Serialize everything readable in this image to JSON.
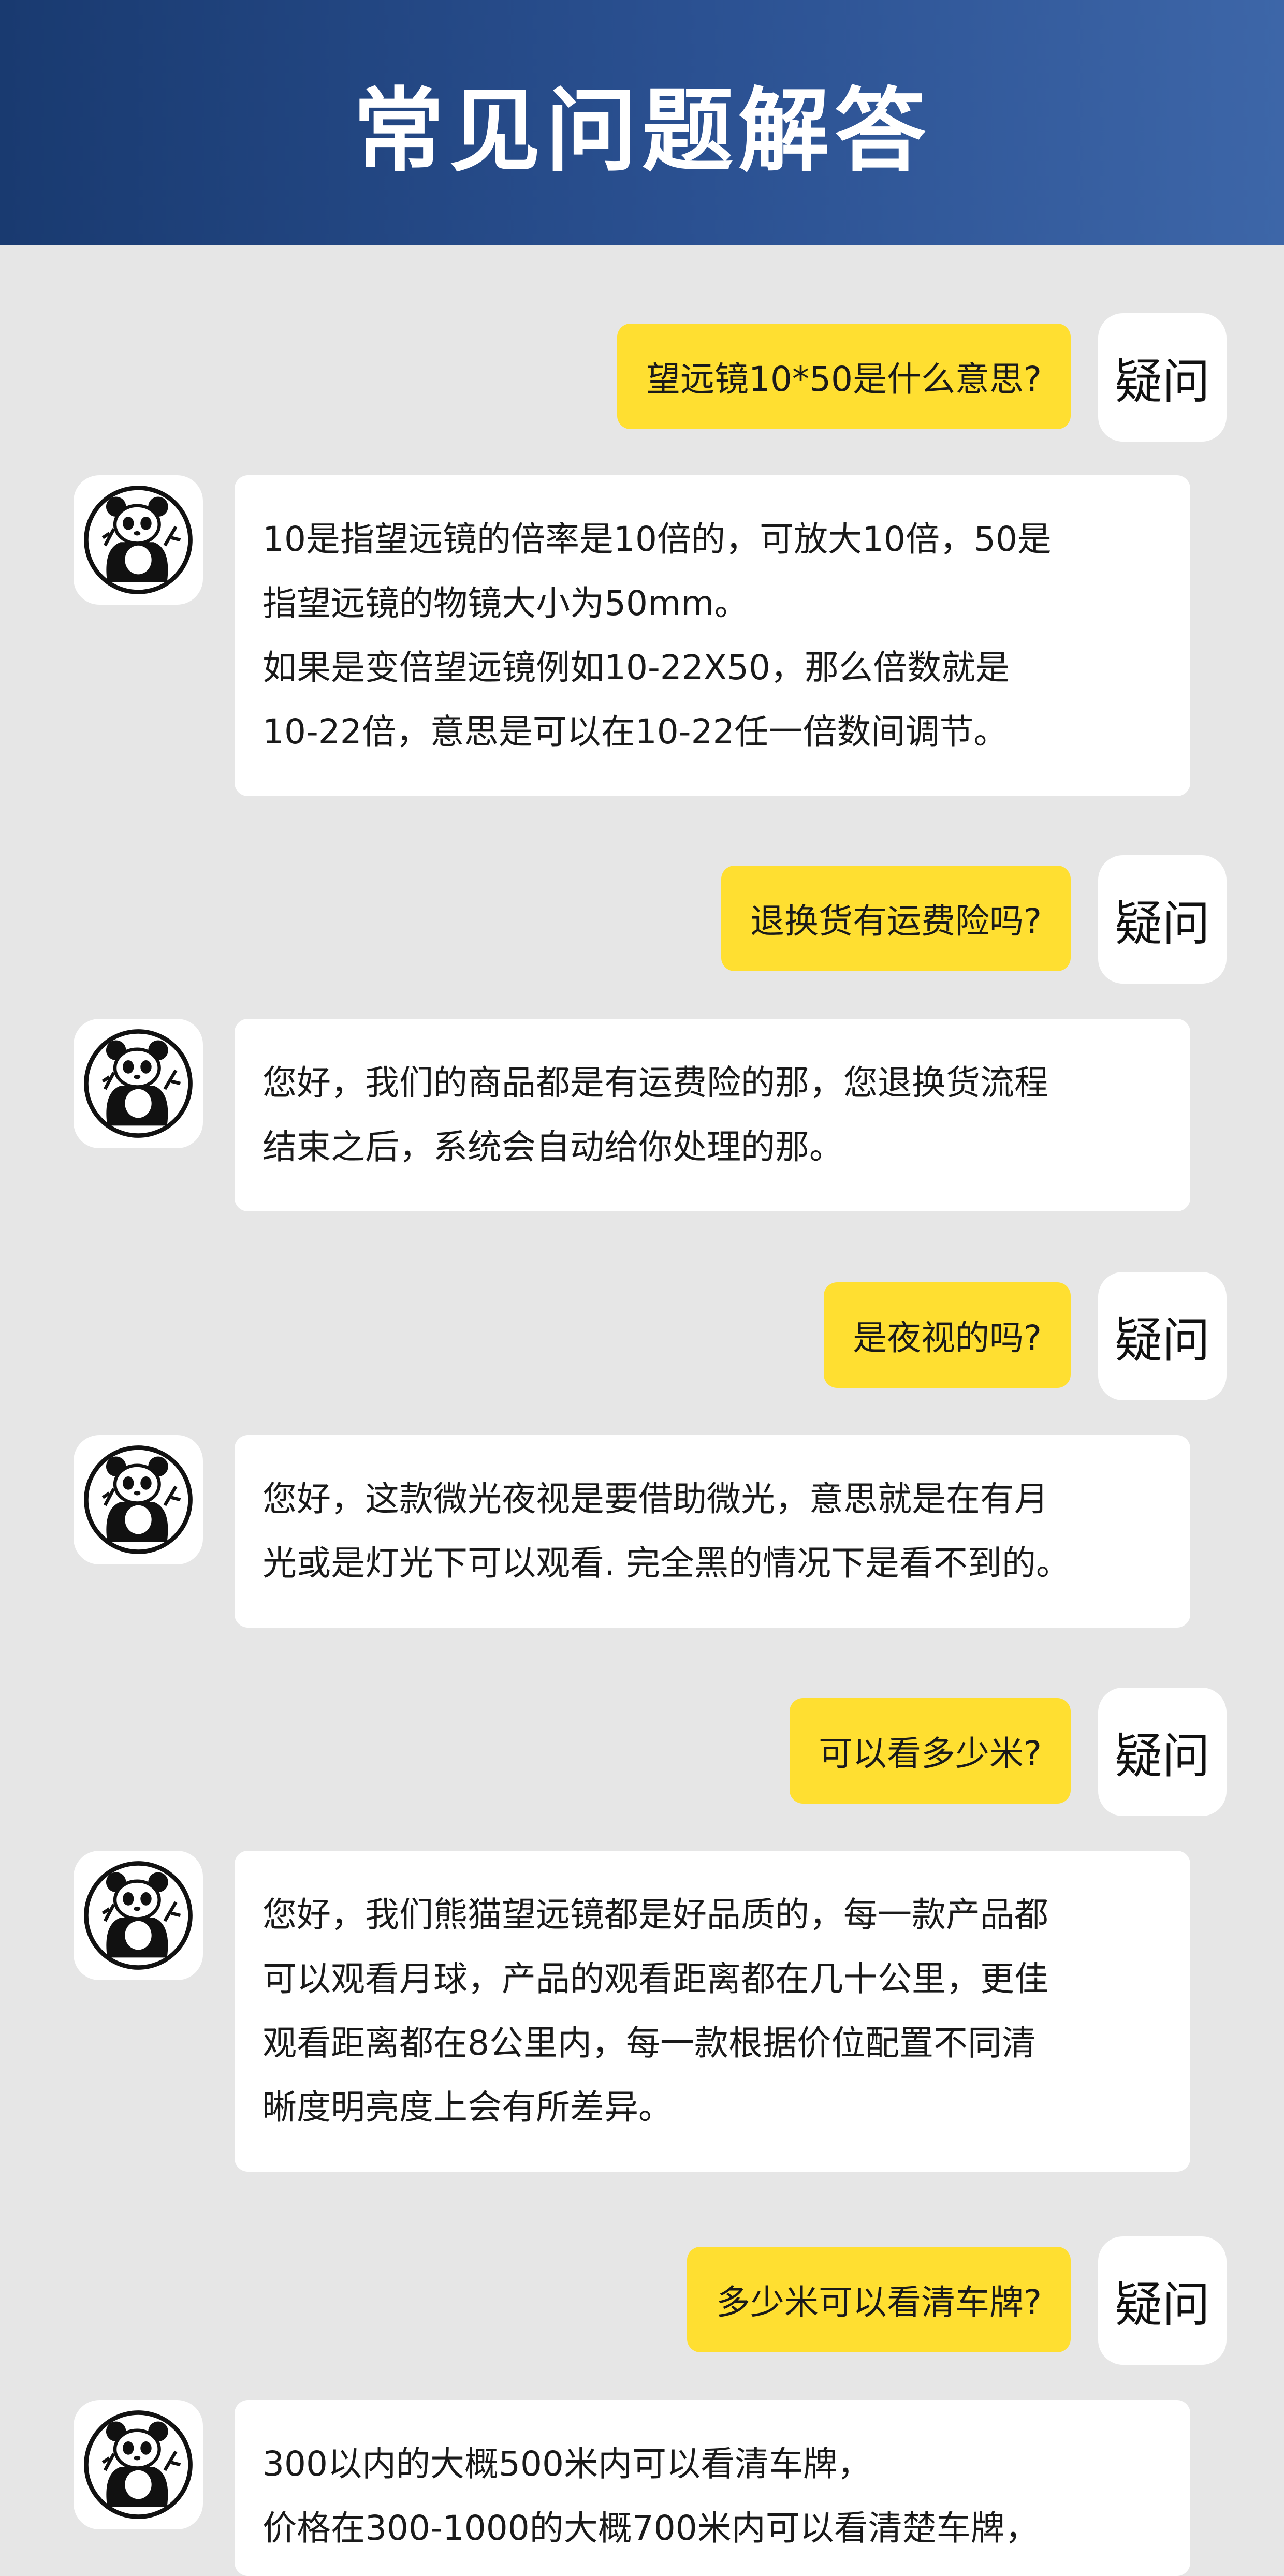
{
  "header": {
    "title": "常见问题解答"
  },
  "faq": [
    {
      "question": "望远镜10*50是什么意思?",
      "tag": "疑问",
      "answer_lines": [
        "10是指望远镜的倍率是10倍的，可放大10倍，50是",
        "指望远镜的物镜大小为50mm。",
        "如果是变倍望远镜例如10-22X50，那么倍数就是",
        "10-22倍，意思是可以在10-22任一倍数间调节。"
      ]
    },
    {
      "question": "退换货有运费险吗?",
      "tag": "疑问",
      "answer_lines": [
        "您好，我们的商品都是有运费险的那，您退换货流程",
        "结束之后，系统会自动给你处理的那。"
      ]
    },
    {
      "question": "是夜视的吗?",
      "tag": "疑问",
      "answer_lines": [
        "您好，这款微光夜视是要借助微光，意思就是在有月",
        "光或是灯光下可以观看. 完全黑的情况下是看不到的。"
      ]
    },
    {
      "question": "可以看多少米?",
      "tag": "疑问",
      "answer_lines": [
        "您好，我们熊猫望远镜都是好品质的，每一款产品都",
        "可以观看月球，产品的观看距离都在几十公里，更佳",
        "观看距离都在8公里内，每一款根据价位配置不同清",
        "晰度明亮度上会有所差异。"
      ]
    },
    {
      "question": "多少米可以看清车牌?",
      "tag": "疑问",
      "answer_lines": [
        "300以内的大概500米内可以看清车牌，",
        "价格在300-1000的大概700米内可以看清楚车牌，"
      ]
    }
  ],
  "colors": {
    "header_start": "#193a70",
    "header_end": "#3d66a8",
    "background": "#e6e6e6",
    "question_bubble": "#ffdf31",
    "answer_bubble": "#ffffff"
  },
  "icons": {
    "avatar": "panda-icon"
  }
}
